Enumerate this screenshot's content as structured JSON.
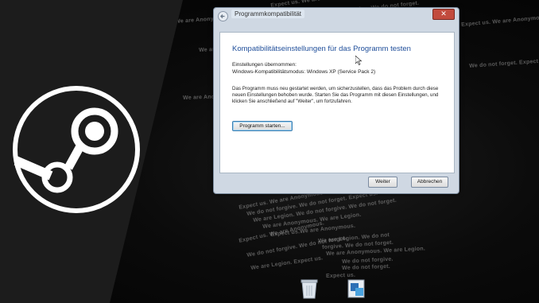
{
  "background": {
    "lines": [
      "Expect us. We are Anonymous. We are Legion.",
      "We do not forgive. We do not forget.",
      "We are Anonymous. We are Legion. We do not forgive.",
      "Expect us. We are Anonymous.",
      "We are Legion. We do not forgive.",
      "We do not forget. Expect us.",
      "We are Anonymous. We are Legion.",
      "Expect us. We are Anonymous. We are Legion. We do not forgive.",
      "We do not forgive. We do not forget. Expect us.",
      "We are Legion. We do not forgive. We do not forget.",
      "We are Anonymous. We are Legion.",
      "Expect us.We are Anonymous.",
      "We are Legion. We do not",
      "forgive. We do not forget.",
      "We are Anonymous. We are Legion.",
      "Expect us. We are Anonymous.",
      "We do not forgive. We do not forget.",
      "We are Legion. Expect us.",
      "We do not forgive.",
      "We do not forget.",
      "Expect us."
    ]
  },
  "window": {
    "title": "Programmkompatibilität",
    "close_label": "✕",
    "heading": "Kompatibilitätseinstellungen für das Programm testen",
    "settings_label": "Einstellungen übernommen:",
    "settings_value": "Windows-Kompatibilitätsmodus: Windows XP (Service Pack 2)",
    "description": "Das Programm muss neu gestartet werden, um sicherzustellen, dass das Problem durch diese neuen Einstellungen behoben wurde. Starten Sie das Programm mit diesen Einstellungen, und klicken Sie anschließend auf \"Weiter\", um fortzufahren.",
    "start_button": "Programm starten...",
    "next_button": "Weiter",
    "cancel_button": "Abbrechen"
  },
  "desktop": {
    "recycle_bin_icon": "recycle-bin-icon",
    "app_icon": "application-icon"
  },
  "colors": {
    "heading": "#1f4e9a",
    "panel": "#1c1c1c",
    "steam_logo": "#ffffff"
  }
}
